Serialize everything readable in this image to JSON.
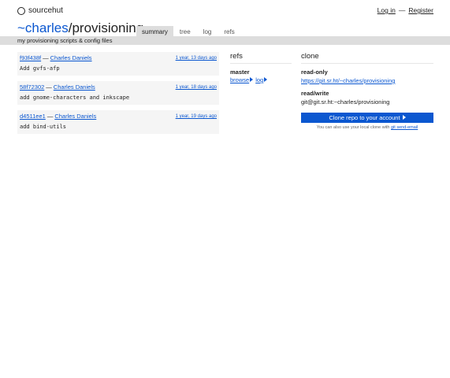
{
  "nav": {
    "brand": "sourcehut",
    "login": "Log in",
    "separator": "—",
    "register": "Register"
  },
  "repo": {
    "owner": "~charles",
    "slash": "/",
    "name": "provisioning",
    "description": "my provisioning scripts & config files"
  },
  "tabs": [
    {
      "label": "summary",
      "active": true
    },
    {
      "label": "tree"
    },
    {
      "label": "log"
    },
    {
      "label": "refs"
    }
  ],
  "commits": [
    {
      "hash": "f93f438f",
      "author": "Charles Daniels",
      "date": "1 year, 13 days ago",
      "message": "Add gvfs-afp"
    },
    {
      "hash": "58f72302",
      "author": "Charles Daniels",
      "date": "1 year, 18 days ago",
      "message": "add gnome-characters and inkscape"
    },
    {
      "hash": "d4511ee1",
      "author": "Charles Daniels",
      "date": "1 year, 19 days ago",
      "message": "add bind-utils"
    }
  ],
  "refs": {
    "title": "refs",
    "branch": "master",
    "browse": "browse",
    "log": "log"
  },
  "clone": {
    "title": "clone",
    "readonly_label": "read-only",
    "readonly_url": "https://git.sr.ht/~charles/provisioning",
    "readwrite_label": "read/write",
    "readwrite_url": "git@git.sr.ht:~charles/provisioning",
    "button": "Clone repo to your account",
    "note_prefix": "You can also use your local clone with ",
    "note_link": "git send-email"
  },
  "colors": {
    "accent": "#0b57d0",
    "subbar": "#dddddd",
    "card": "#f5f5f5"
  }
}
